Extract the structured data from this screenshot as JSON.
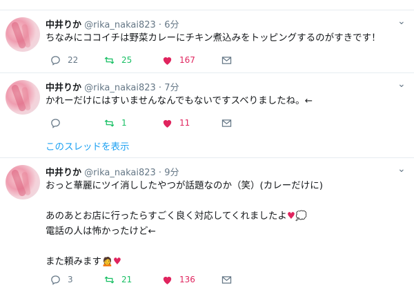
{
  "tweets": [
    {
      "name": "中井りか",
      "handle": "@rika_nakai823",
      "dot": "·",
      "time": "6分",
      "lines": [
        "ちなみにココイチは野菜カレーにチキン煮込みをトッピングするのがすきです！"
      ],
      "reply_count": "22",
      "retweet_count": "25",
      "like_count": "167"
    },
    {
      "name": "中井りか",
      "handle": "@rika_nakai823",
      "dot": "·",
      "time": "7分",
      "lines": [
        "かれーだけにはすいませんなんでもないですスベりましたね。←"
      ],
      "reply_count": "",
      "retweet_count": "1",
      "like_count": "11",
      "thread_link": "このスレッドを表示"
    },
    {
      "name": "中井りか",
      "handle": "@rika_nakai823",
      "dot": "·",
      "time": "9分",
      "lines": [
        "おっと華麗にツイ消ししたやつが話題なのか（笑）(カレーだけに)",
        "",
        "あのあとお店に行ったらすごく良く対応してくれましたよ",
        "電話の人は怖かったけど←",
        "",
        "また頼みます"
      ],
      "emoji_after_line3": [
        "♥",
        "💭"
      ],
      "emoji_after_line6": [
        "🙍",
        "♥"
      ],
      "reply_count": "3",
      "retweet_count": "21",
      "like_count": "136"
    }
  ],
  "icons": {
    "reply": "reply-icon",
    "retweet": "retweet-icon",
    "like": "heart-icon",
    "dm": "envelope-icon",
    "menu": "chevron-down-icon"
  },
  "colors": {
    "retweet": "#17bf63",
    "like": "#e0245e",
    "link": "#1da1f2",
    "muted": "#657786"
  }
}
